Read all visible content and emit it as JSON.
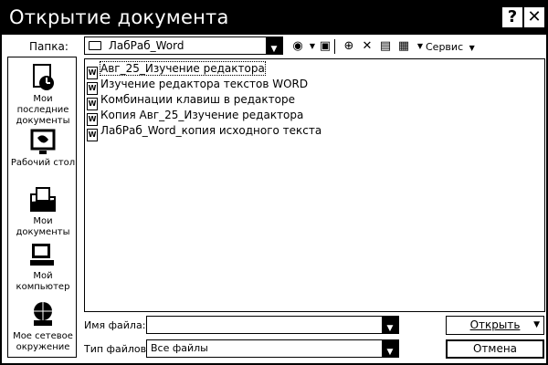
{
  "window": {
    "title": "Открытие документа",
    "help_glyph": "?",
    "close_glyph": "✕"
  },
  "toolbar": {
    "folder_label": "Папка:",
    "folder_value": "ЛабРаб_Word",
    "service_label": "Сервис",
    "icons": [
      "back-icon",
      "up-folder-icon",
      "search-web-icon",
      "delete-icon",
      "new-folder-icon",
      "views-icon"
    ]
  },
  "places": [
    {
      "label": "Мои последние документы",
      "icon": "recent-documents-icon"
    },
    {
      "label": "Рабочий стол",
      "icon": "desktop-icon"
    },
    {
      "label": "Мои документы",
      "icon": "my-documents-icon"
    },
    {
      "label": "Мой компьютер",
      "icon": "my-computer-icon"
    },
    {
      "label": "Мое сетевое окружение",
      "icon": "network-icon"
    }
  ],
  "files": [
    {
      "name": "Авг_25_Изучение редактора",
      "selected": true
    },
    {
      "name": "Изучение редактора текстов  WORD",
      "selected": false
    },
    {
      "name": "Комбинации клавиш в редакторе",
      "selected": false
    },
    {
      "name": "Копия Авг_25_Изучение редактора",
      "selected": false
    },
    {
      "name": "ЛабРаб_Word_копия исходного текста",
      "selected": false
    }
  ],
  "filename": {
    "label": "Имя файла:",
    "value": ""
  },
  "filetype": {
    "label": "Тип файлов:",
    "value": "Все файлы"
  },
  "buttons": {
    "open": "Открыть",
    "cancel": "Отмена"
  }
}
